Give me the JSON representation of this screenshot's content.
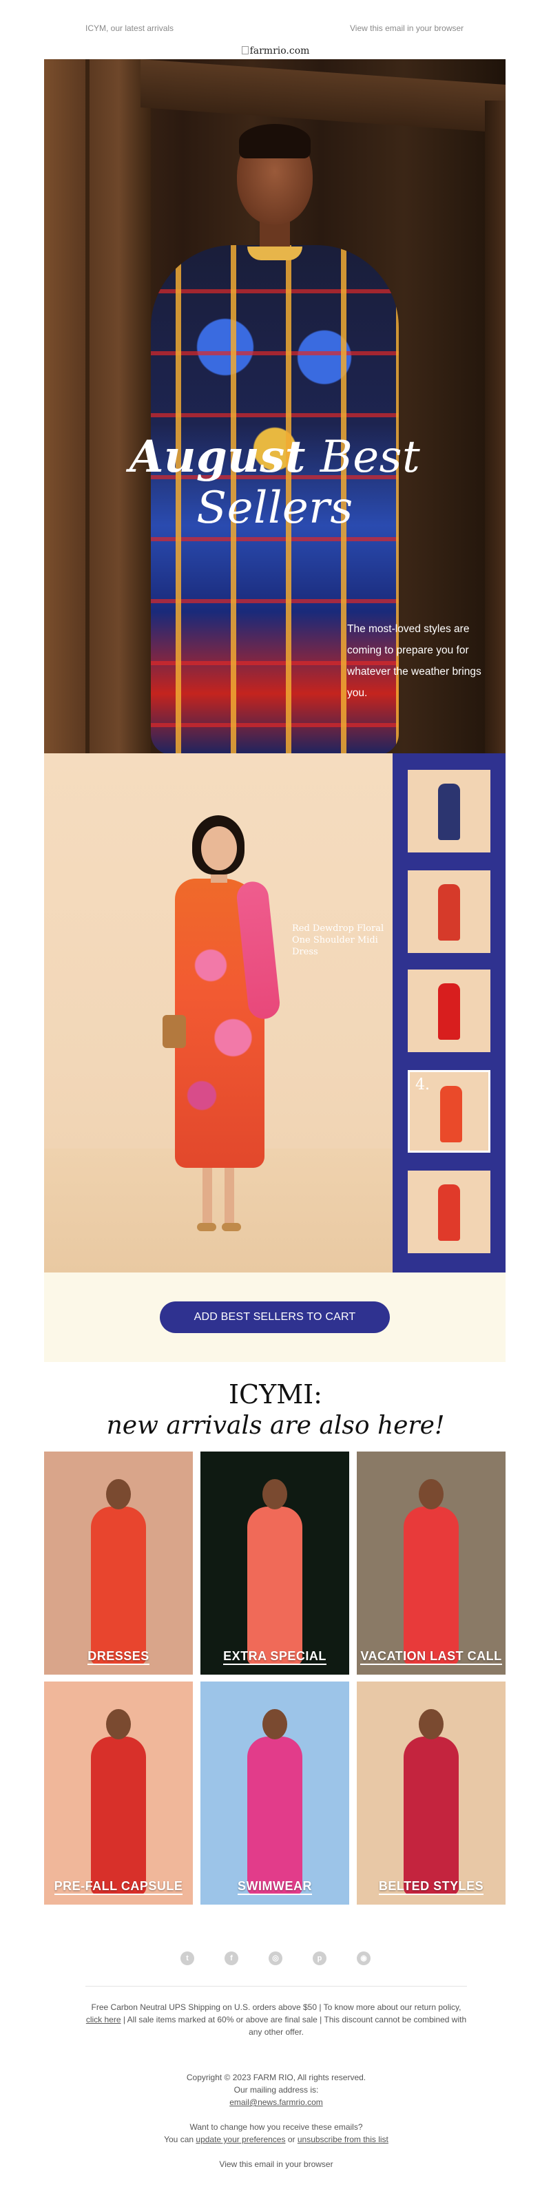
{
  "preheader": {
    "left_text": "ICYM, our latest arrivals",
    "right_text": "View this email in your browser"
  },
  "logo": {
    "alt": "farmrio.com"
  },
  "hero": {
    "title_bold": "August",
    "title_light": "Best Sellers",
    "copy": "The most-loved styles are coming to prepare you for whatever the weather brings you."
  },
  "feature": {
    "caption": "Red Dewdrop Floral One Shoulder Midi Dress",
    "thumbs": [
      {
        "name": "Blue Knit Dress",
        "number": "",
        "color": "#2c3570"
      },
      {
        "name": "Red Print Maxi Dress",
        "number": "",
        "color": "#d63a2a"
      },
      {
        "name": "Red Wrap Dress",
        "number": "",
        "color": "#d81e1e"
      },
      {
        "name": "Red Dewdrop Floral One Shoulder Midi Dress",
        "number": "4.",
        "color": "#ea4a2a"
      },
      {
        "name": "Red Floral Romper",
        "number": "",
        "color": "#e03a2a"
      }
    ],
    "active_index": 3,
    "cta": "ADD BEST SELLERS TO CART"
  },
  "icymi": {
    "line1": "ICYMI:",
    "line2": "new arrivals are also here!"
  },
  "categories": [
    {
      "label": "DRESSES",
      "bg": "#d9a58a",
      "fig": "#e8452e"
    },
    {
      "label": "EXTRA SPECIAL",
      "bg": "#0f1a12",
      "fig": "#f06a58"
    },
    {
      "label": "VACATION LAST CALL",
      "bg": "#8a7a66",
      "fig": "#e83a3a"
    },
    {
      "label": "PRE-FALL CAPSULE",
      "bg": "#f0b79a",
      "fig": "#d8302a"
    },
    {
      "label": "SWIMWEAR",
      "bg": "#9cc4e8",
      "fig": "#e23c8a"
    },
    {
      "label": "BELTED STYLES",
      "bg": "#e8c8a6",
      "fig": "#c4243e"
    }
  ],
  "social": [
    "twitter-icon",
    "facebook-icon",
    "instagram-icon",
    "pinterest-icon",
    "website-icon"
  ],
  "footer": {
    "shipping_pre": "Free Carbon Neutral UPS Shipping on U.S. orders above $50 | To know more about our return policy,",
    "click_here": "click here",
    "shipping_post": "| All sale items marked at 60% or above are final sale | This discount cannot be combined with any other offer.",
    "copyright": "Copyright © 2023 FARM RIO, All rights reserved.",
    "mailing_label": "Our mailing address is:",
    "email": "email@news.farmrio.com",
    "change_text": "Want to change how you receive these emails?",
    "you_can": "You can",
    "update_prefs": "update your preferences",
    "or": "or",
    "unsubscribe": "unsubscribe from this list",
    "view_browser": "View this email in your browser"
  }
}
